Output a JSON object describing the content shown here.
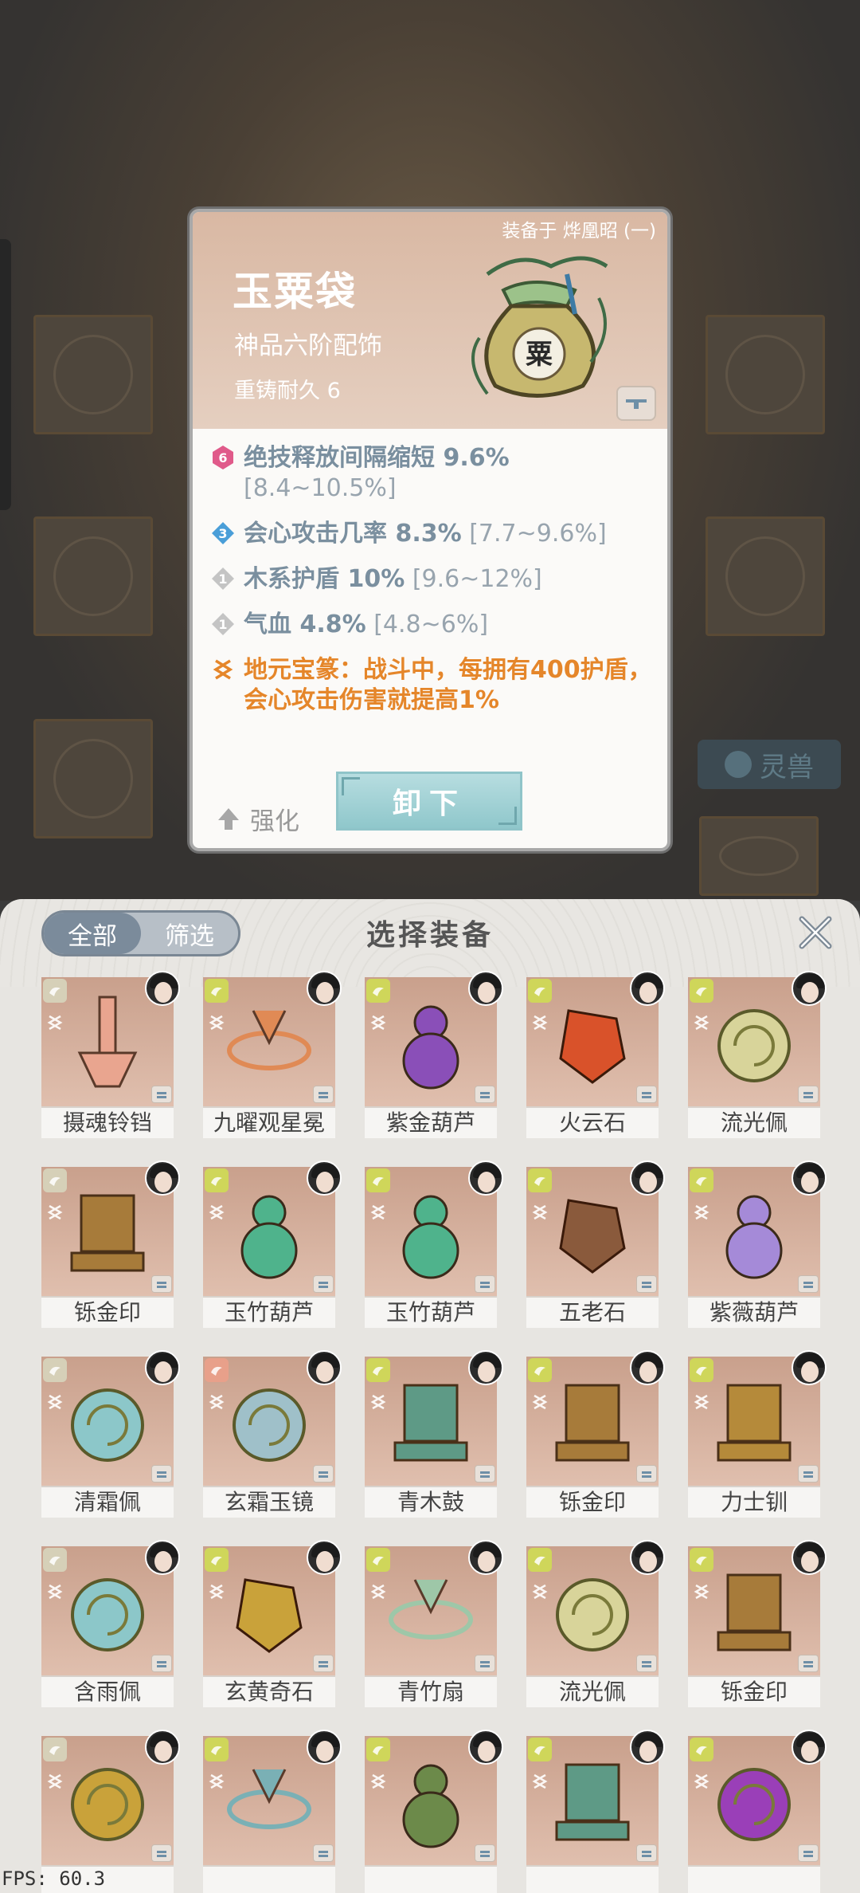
{
  "detail": {
    "equipped_label": "装备于 烨凰昭 (一)",
    "title": "玉粟袋",
    "grade": "神品六阶配饰",
    "durability": "重铸耐久 6",
    "art_char": "粟",
    "stats": [
      {
        "level": "6",
        "name": "绝技释放间隔缩短 9.6%",
        "range": "[8.4~10.5%]",
        "color": "#e05a8a"
      },
      {
        "level": "3",
        "name": "会心攻击几率 8.3%",
        "range": "[7.7~9.6%]",
        "color": "#4a9ed8"
      },
      {
        "level": "1",
        "name": "木系护盾 10%",
        "range": "[9.6~12%]",
        "color": "#b5b5b5"
      },
      {
        "level": "1",
        "name": "气血 4.8%",
        "range": "[4.8~6%]",
        "color": "#b5b5b5"
      }
    ],
    "special": "地元宝篆：战斗中，每拥有400护盾，会心攻击伤害就提高1%",
    "upgrade_label": "强化",
    "unequip_label": "卸下"
  },
  "panel": {
    "title": "选择装备",
    "tabs": [
      "全部",
      "筛选"
    ],
    "items": [
      {
        "name": "摄魂铃铛",
        "color": "#e9a58f"
      },
      {
        "name": "九曜观星冕",
        "color": "#e08a55"
      },
      {
        "name": "紫金葫芦",
        "color": "#8a4fb8"
      },
      {
        "name": "火云石",
        "color": "#d9522a"
      },
      {
        "name": "流光佩",
        "color": "#d8d49a"
      },
      {
        "name": "铄金印",
        "color": "#a77b3a"
      },
      {
        "name": "玉竹葫芦",
        "color": "#4fb38c"
      },
      {
        "name": "玉竹葫芦",
        "color": "#4fb38c"
      },
      {
        "name": "五老石",
        "color": "#8a5a3c"
      },
      {
        "name": "紫薇葫芦",
        "color": "#a58ad8"
      },
      {
        "name": "清霜佩",
        "color": "#8cc7c9"
      },
      {
        "name": "玄霜玉镜",
        "color": "#9fc0c9"
      },
      {
        "name": "青木鼓",
        "color": "#5e9a86"
      },
      {
        "name": "铄金印",
        "color": "#a77b3a"
      },
      {
        "name": "力士钏",
        "color": "#b58a3a"
      },
      {
        "name": "含雨佩",
        "color": "#8cc7c9"
      },
      {
        "name": "玄黄奇石",
        "color": "#c9a23a"
      },
      {
        "name": "青竹扇",
        "color": "#9ec7a8"
      },
      {
        "name": "流光佩",
        "color": "#d8d49a"
      },
      {
        "name": "铄金印",
        "color": "#a77b3a"
      },
      {
        "name": "",
        "color": "#c9a23a"
      },
      {
        "name": "",
        "color": "#7ab0b5"
      },
      {
        "name": "",
        "color": "#6c8a4a"
      },
      {
        "name": "",
        "color": "#5e9a86"
      },
      {
        "name": "",
        "color": "#9a3fb8"
      }
    ]
  },
  "background": {
    "pill_label": "灵兽"
  },
  "fps": "FPS: 60.3"
}
